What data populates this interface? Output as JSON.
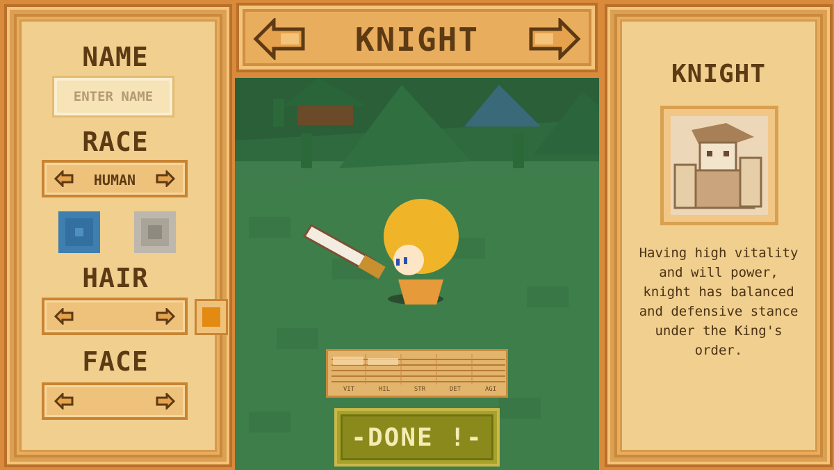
{
  "header": {
    "class_title": "KNIGHT"
  },
  "left_panel": {
    "name_heading": "NAME",
    "name_placeholder": "ENTER NAME",
    "race_heading": "RACE",
    "race_value": "HUMAN",
    "hair_heading": "HAIR",
    "face_heading": "FACE"
  },
  "stats": {
    "labels": [
      "VIT",
      "HIL",
      "STR",
      "DET",
      "AGI"
    ]
  },
  "done_button": {
    "label": "-DONE !-"
  },
  "right_panel": {
    "class_heading": "KNIGHT",
    "description": "Having high vitality and will power, knight has balanced and defensive stance under the King's order."
  },
  "colors": {
    "panel": "#e9ad5e",
    "text_brown": "#5c3a14",
    "done_green": "#8a8a1c",
    "hair_swatch": "#e38a12",
    "skin_swatch_blue": "#3f7fb0",
    "swatch_gray": "#bdb7ad"
  }
}
